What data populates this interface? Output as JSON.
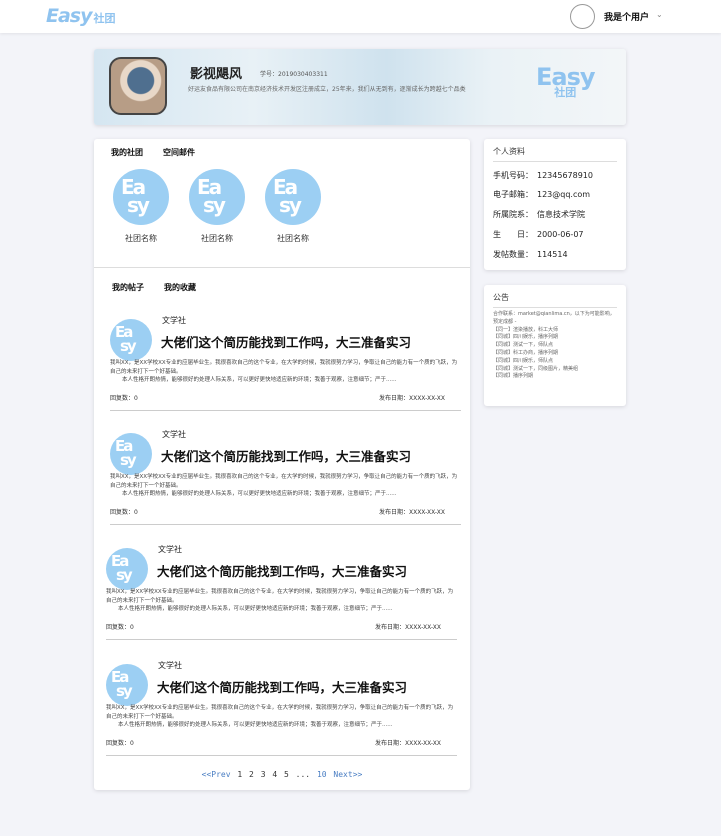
{
  "header": {
    "brand_word": "Easy",
    "brand_sub": "社团",
    "user_name": "我是个用户",
    "dropdown_icon": "chevron-down-icon"
  },
  "profile": {
    "name": "影视飓风",
    "id_label": "学号：",
    "id_value": "2019030403311",
    "desc": "好运友食品有限公司在南京经济技术开发区注册成立，25年来，我们从无到有，逐渐成长为跨越七个品类",
    "logo_word": "Easy",
    "logo_sub": "社团"
  },
  "clubs_panel": {
    "tabs": [
      "我的社团",
      "空间邮件"
    ],
    "items": [
      {
        "name": "社团名称"
      },
      {
        "name": "社团名称"
      },
      {
        "name": "社团名称"
      }
    ]
  },
  "posts_panel": {
    "tabs": [
      "我的帖子",
      "我的收藏"
    ],
    "posts": [
      {
        "category": "文学社",
        "title": "大佬们这个简历能找到工作吗，大三准备实习",
        "body1": "我叫XX，是XX学校XX专业的应届毕业生。我很喜欢自己的这个专业，在大学的时候，我就很努力学习，争取让自己的能力有一个质的飞跃，为自己的未来打下一个好基础。",
        "body2": "本人性格开朗热情，能够很好的处理人际关系，可以更好更快地适应新的环境；我善于观察，注意细节；严于......",
        "reply_label": "回复数：",
        "reply_count": "0",
        "date_label": "发布日期：",
        "date_value": "XXXX-XX-XX"
      },
      {
        "category": "文学社",
        "title": "大佬们这个简历能找到工作吗，大三准备实习",
        "body1": "我叫XX，是XX学校XX专业的应届毕业生。我很喜欢自己的这个专业，在大学的时候，我就很努力学习，争取让自己的能力有一个质的飞跃，为自己的未来打下一个好基础。",
        "body2": "本人性格开朗热情，能够很好的处理人际关系，可以更好更快地适应新的环境；我善于观察，注意细节；严于......",
        "reply_label": "回复数：",
        "reply_count": "0",
        "date_label": "发布日期：",
        "date_value": "XXXX-XX-XX"
      },
      {
        "category": "文学社",
        "title": "大佬们这个简历能找到工作吗，大三准备实习",
        "body1": "我叫XX，是XX学校XX专业的应届毕业生。我很喜欢自己的这个专业，在大学的时候，我就很努力学习，争取让自己的能力有一个质的飞跃，为自己的未来打下一个好基础。",
        "body2": "本人性格开朗热情，能够很好的处理人际关系，可以更好更快地适应新的环境；我善于观察，注意细节；严于......",
        "reply_label": "回复数：",
        "reply_count": "0",
        "date_label": "发布日期：",
        "date_value": "XXXX-XX-XX"
      },
      {
        "category": "文学社",
        "title": "大佬们这个简历能找到工作吗，大三准备实习",
        "body1": "我叫XX，是XX学校XX专业的应届毕业生。我很喜欢自己的这个专业，在大学的时候，我就很努力学习，争取让自己的能力有一个质的飞跃，为自己的未来打下一个好基础。",
        "body2": "本人性格开朗热情，能够很好的处理人际关系，可以更好更快地适应新的环境；我善于观察，注意细节；严于......",
        "reply_label": "回复数：",
        "reply_count": "0",
        "date_label": "发布日期：",
        "date_value": "XXXX-XX-XX"
      }
    ],
    "pager": {
      "prev": "<<Prev",
      "pages": [
        "1",
        "2",
        "3",
        "4",
        "5"
      ],
      "ellipsis": "...",
      "last": "10",
      "next": "Next>>"
    }
  },
  "personal_info": {
    "title": "个人资料",
    "rows": [
      {
        "label": "手机号码：",
        "value": "12345678910"
      },
      {
        "label": "电子邮箱：",
        "value": "123@qq.com"
      },
      {
        "label": "所属院系：",
        "value": "信息技术学院"
      },
      {
        "label": "生　　日：",
        "value": "2000-06-07"
      },
      {
        "label": "发帖数量：",
        "value": "114514"
      }
    ]
  },
  "announcement": {
    "title": "公告",
    "lines": [
      "合作联系：market@qianlima.cn，以下为可能影响，预定成都 -",
      "【同一】渲染播放，科工大师",
      "【同城】四川娱乐，播序列期",
      "【同城】测试一下，师队点",
      "【同城】科工办商，播序列期",
      "【同城】四川娱乐，师队点",
      "【同城】测试一下，同级图片，精美组",
      "【同城】播序列期"
    ]
  },
  "colors": {
    "accent": "#9ccff3",
    "link": "#4a7ec3",
    "background": "#f3f4f9"
  }
}
